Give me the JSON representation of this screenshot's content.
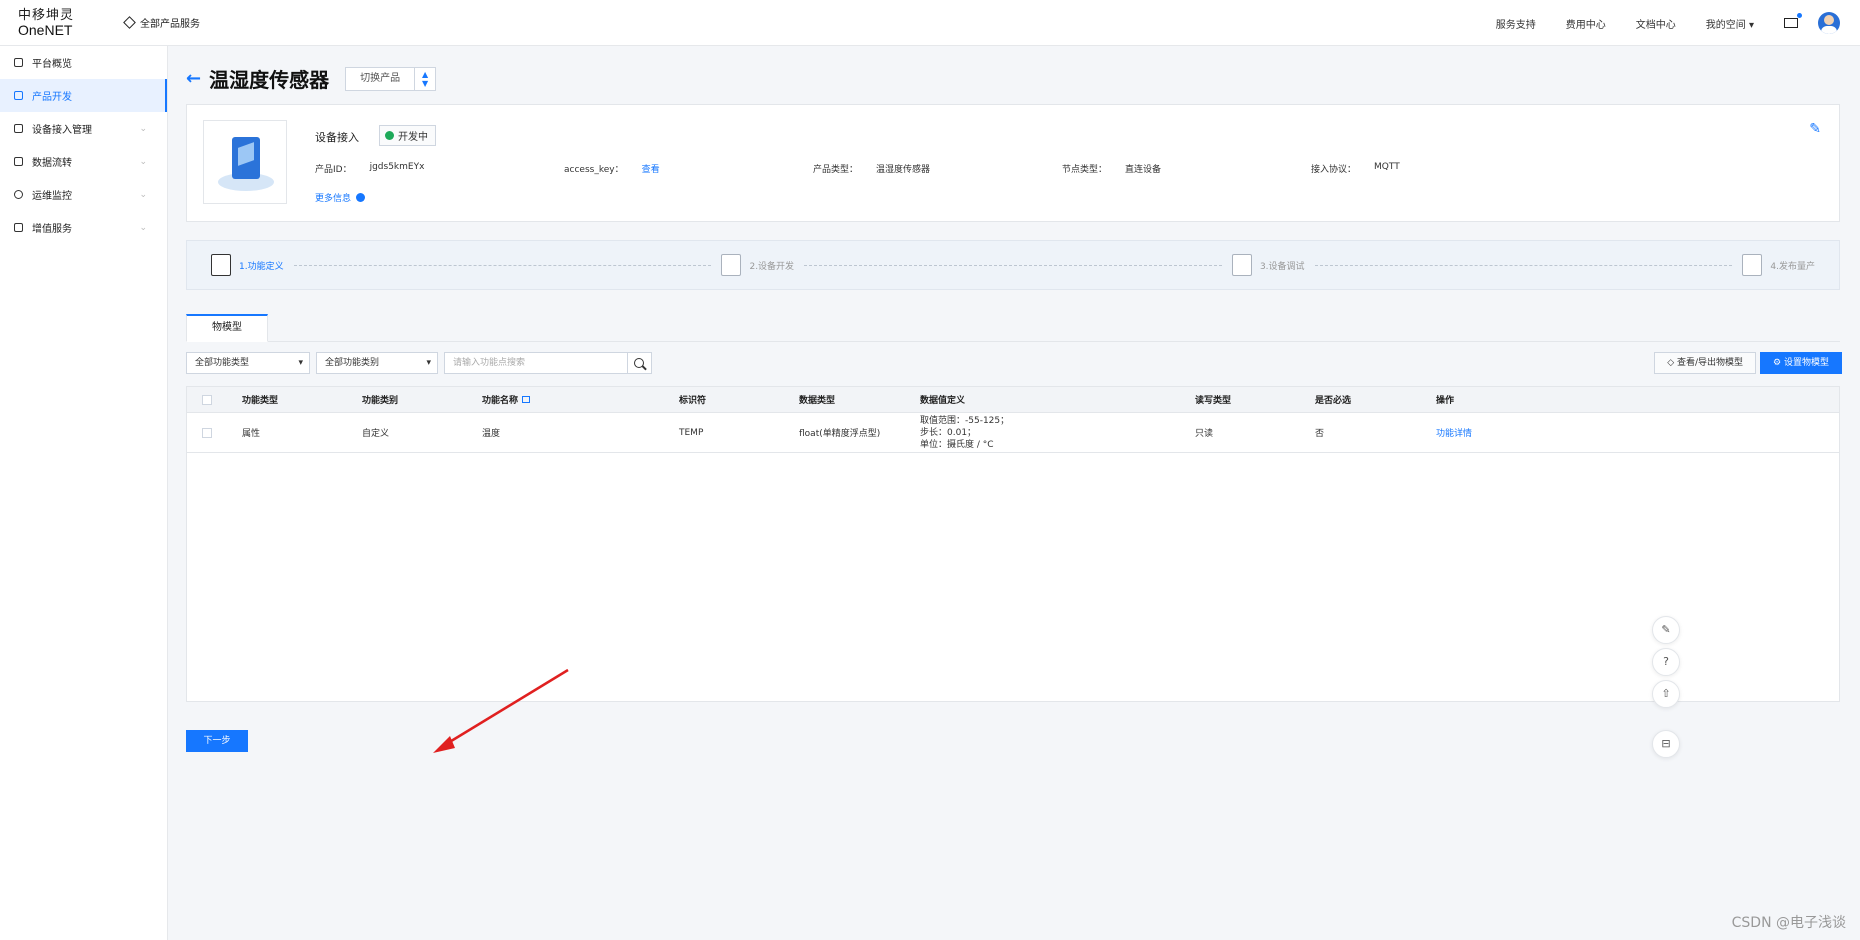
{
  "topbar": {
    "logo_cn": "中移坤灵",
    "logo_en": "OneNET",
    "all_products": "全部产品服务",
    "links": [
      "服务支持",
      "费用中心",
      "文档中心"
    ],
    "space": "我的空间"
  },
  "sidebar": {
    "items": [
      {
        "label": "平台概览",
        "chevron": false
      },
      {
        "label": "产品开发",
        "chevron": false
      },
      {
        "label": "设备接入管理",
        "chevron": true
      },
      {
        "label": "数据流转",
        "chevron": true
      },
      {
        "label": "运维监控",
        "chevron": true
      },
      {
        "label": "增值服务",
        "chevron": true
      }
    ]
  },
  "header": {
    "title": "温湿度传感器",
    "switch_label": "切换产品"
  },
  "product": {
    "section": "设备接入",
    "status": "开发中",
    "id_label": "产品ID：",
    "id_value": "jgds5kmEYx",
    "key_label": "access_key：",
    "key_value": "查看",
    "type_label": "产品类型：",
    "type_value": "温湿度传感器",
    "node_label": "节点类型：",
    "node_value": "直连设备",
    "proto_label": "接入协议：",
    "proto_value": "MQTT",
    "more": "更多信息"
  },
  "steps": [
    "1.功能定义",
    "2.设备开发",
    "3.设备调试",
    "4.发布量产"
  ],
  "tab": "物模型",
  "filters": {
    "type": "全部功能类型",
    "category": "全部功能类别",
    "search_placeholder": "请输入功能点搜索"
  },
  "actions": {
    "view_export": "查看/导出物模型",
    "set_model": "设置物模型"
  },
  "table": {
    "headers": [
      "功能类型",
      "功能类别",
      "功能名称",
      "标识符",
      "数据类型",
      "数据值定义",
      "读写类型",
      "是否必选",
      "操作"
    ],
    "rows": [
      {
        "type": "属性",
        "category": "自定义",
        "name": "温度",
        "identifier": "TEMP",
        "datatype": "float(单精度浮点型)",
        "def1": "取值范围：-55-125；",
        "def2": "步长：0.01；",
        "def3": "单位：摄氏度 / °C",
        "rw": "只读",
        "required": "否",
        "op": "功能详情"
      }
    ]
  },
  "next_button": "下一步",
  "watermark": "CSDN @电子浅谈"
}
